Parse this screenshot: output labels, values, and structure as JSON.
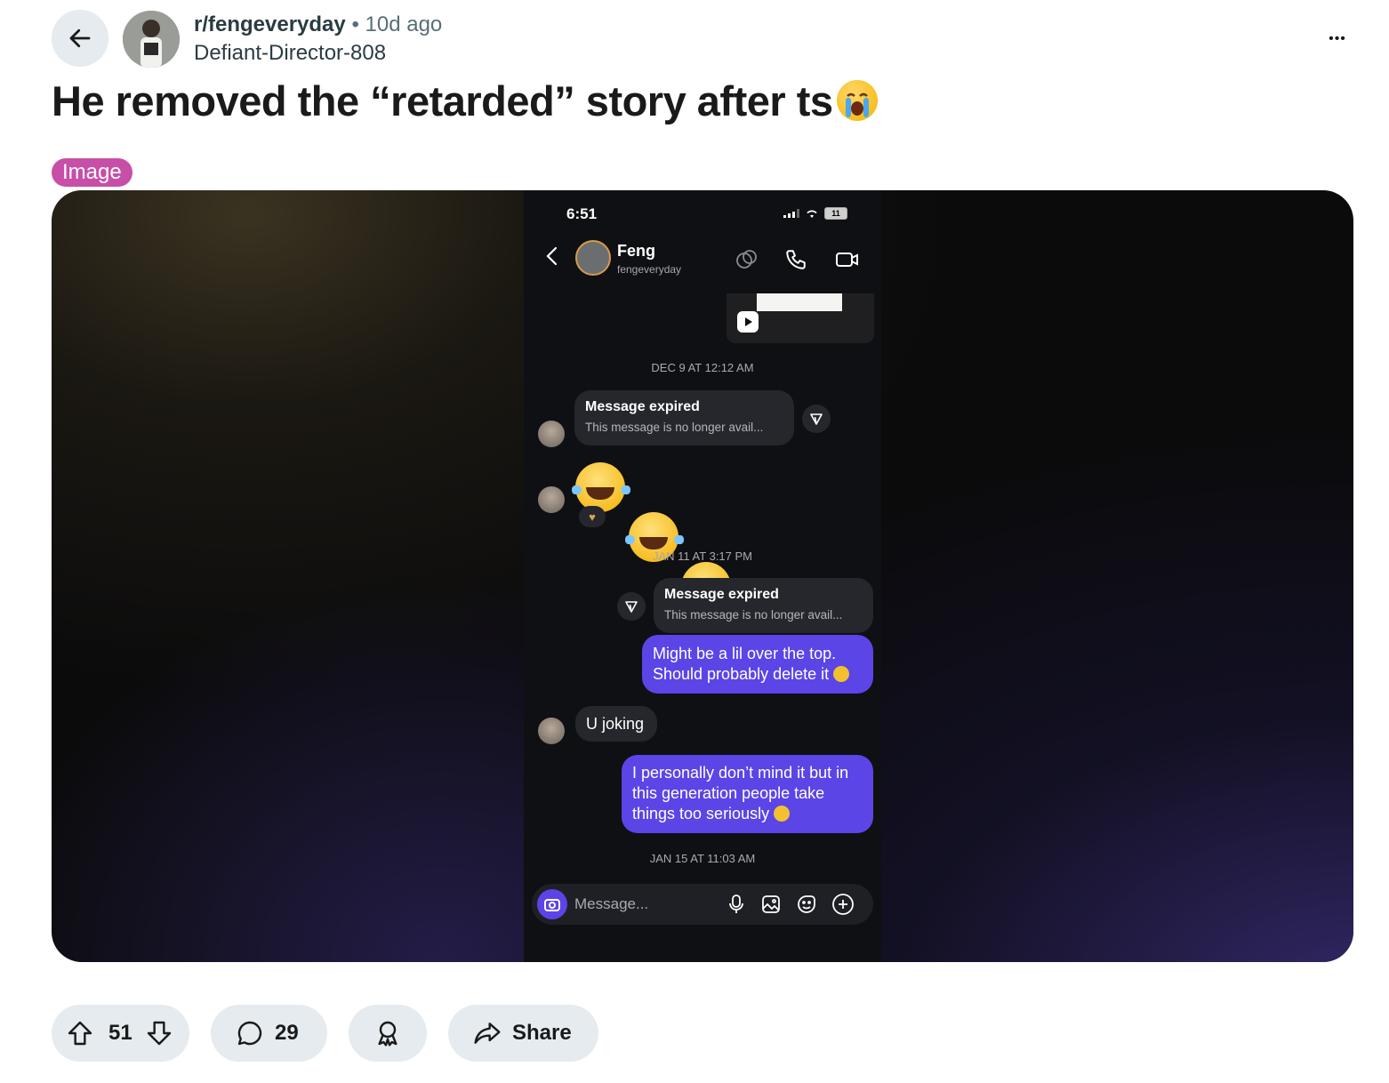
{
  "header": {
    "subreddit": "r/fengeveryday",
    "separator": "•",
    "time_ago": "10d ago",
    "author": "Defiant-Director-808",
    "more_label": "•••"
  },
  "post": {
    "title": "He removed the “retarded” story after ts",
    "flair": "Image"
  },
  "screenshot": {
    "status_time": "6:51",
    "battery": "11",
    "contact_name": "Feng",
    "contact_handle": "fengeveryday",
    "ts1": "DEC 9 AT 12:12 AM",
    "expired1_title": "Message expired",
    "expired1_sub": "This message is no longer avail...",
    "reaction": "♥",
    "ts2": "JAN 11 AT 3:17 PM",
    "expired2_title": "Message expired",
    "expired2_sub": "This message is no longer avail...",
    "msg_sent1_line1": "Might be a lil over the top.",
    "msg_sent1_line2": "Should probably delete it",
    "msg_recv": "U joking",
    "msg_sent2_line1": "I personally don’t mind it but in",
    "msg_sent2_line2": "this generation people take",
    "msg_sent2_line3": "things too seriously",
    "ts3": "JAN 15 AT 11:03 AM",
    "composer_placeholder": "Message..."
  },
  "actions": {
    "upvotes": "51",
    "comments": "29",
    "share_label": "Share"
  },
  "colors": {
    "flair_bg": "#c74fa8",
    "sent_bubble": "#5b45e6",
    "pill_bg": "#e5ebee"
  }
}
